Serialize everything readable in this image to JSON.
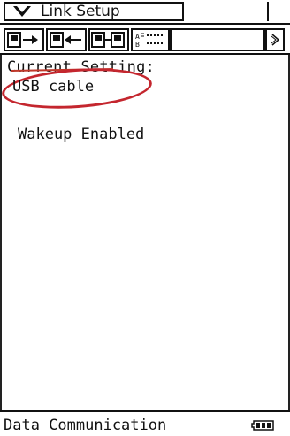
{
  "title_bar": {
    "menu_label": "Link Setup"
  },
  "content": {
    "heading": "Current Setting:",
    "connection": "USB cable",
    "wakeup": "Wakeup Enabled"
  },
  "status_bar": {
    "label": "Data Communication"
  },
  "icons": {
    "menu": "chevron-down-icon",
    "send": "send-data-icon",
    "receive": "receive-data-icon",
    "transfer": "transfer-data-icon",
    "settings": "list-settings-icon",
    "scroll": "arrow-right-icon",
    "battery": "battery-icon"
  },
  "colors": {
    "annotation": "#c4262e"
  }
}
